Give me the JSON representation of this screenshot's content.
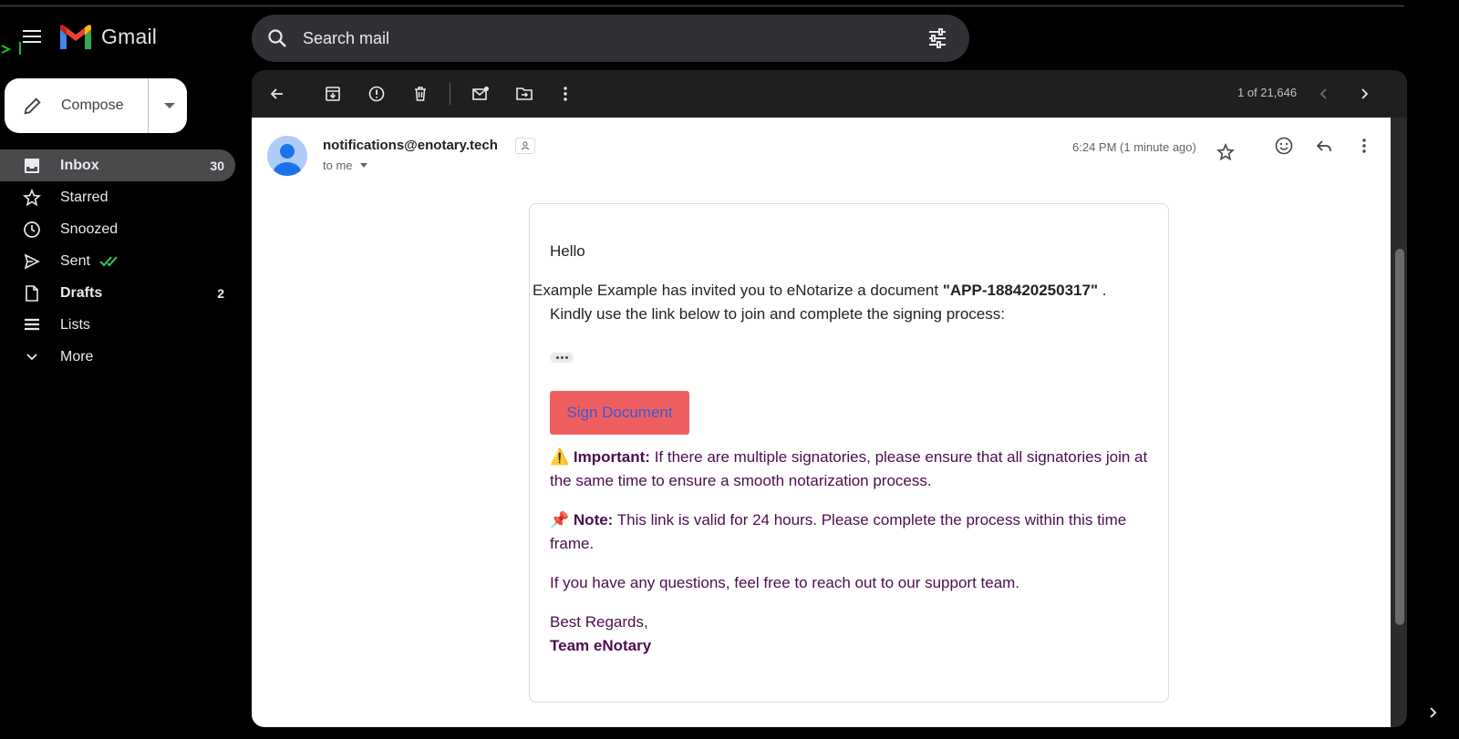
{
  "app": {
    "name": "Gmail"
  },
  "search": {
    "placeholder": "Search mail"
  },
  "compose": {
    "label": "Compose"
  },
  "nav": [
    {
      "label": "Inbox",
      "count": "30"
    },
    {
      "label": "Starred",
      "count": ""
    },
    {
      "label": "Snoozed",
      "count": ""
    },
    {
      "label": "Sent",
      "count": ""
    },
    {
      "label": "Drafts",
      "count": "2"
    },
    {
      "label": "Lists",
      "count": ""
    },
    {
      "label": "More",
      "count": ""
    }
  ],
  "toolbar": {
    "pager": "1 of 21,646"
  },
  "message": {
    "sender": "notifications@enotary.tech",
    "to": "to me",
    "time": "6:24 PM (1 minute ago)"
  },
  "email": {
    "greeting": "Hello",
    "inviter": "Example Example",
    "invite_text": "has invited you to eNotarize a document",
    "doc": "\"APP-188420250317\"",
    "period": ".",
    "instruction": "Kindly use the link below to join and complete the signing process:",
    "button": "Sign Document",
    "important_emoji": "⚠️",
    "important_label": "Important:",
    "important_text": "If there are multiple signatories, please ensure that all signatories join at the same time to ensure a smooth notarization process.",
    "note_emoji": "📌",
    "note_label": "Note:",
    "note_text": "This link is valid for 24 hours. Please complete the process within this time frame.",
    "questions": "If you have any questions, feel free to reach out to our support team.",
    "regards": "Best Regards,",
    "team": "Team eNotary"
  },
  "colors": {
    "button_bg": "#f05f5f",
    "button_text": "#3a57d6",
    "body_purple": "#4a0e4e",
    "nav_active": "#4a4a4c"
  }
}
